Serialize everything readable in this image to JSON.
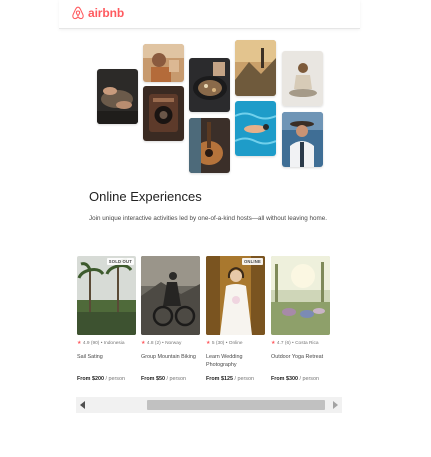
{
  "header": {
    "brand": "airbnb",
    "brand_color": "#ff5a5f",
    "logo_icon": "airbnb-belo-icon"
  },
  "hero": {
    "title": "Online Experiences",
    "description": "Join unique interactive activities led by one-of-a-kind hosts—all without leaving home."
  },
  "cards": [
    {
      "badge": "SOLD OUT",
      "rating": "4.9",
      "reviews": "(90)",
      "location": "Indonesia",
      "title": "Sail Sating",
      "price": "From $200",
      "unit": " / person"
    },
    {
      "badge": "",
      "rating": "4.8",
      "reviews": "(2)",
      "location": "Norway",
      "title": "Group Mountain Biking",
      "price": "From $50",
      "unit": " / person"
    },
    {
      "badge": "ONLINE",
      "rating": "5",
      "reviews": "(30)",
      "location": "Online",
      "title": "Learn Wedding Photography",
      "price": "From $125",
      "unit": " / person"
    },
    {
      "badge": "",
      "rating": "4.7",
      "reviews": "(6)",
      "location": "Costa Rica",
      "title": "Outdoor Yoga Retreat",
      "price": "From $300",
      "unit": " / person"
    }
  ],
  "scrollbar": {
    "left_icon": "scroll-left-arrow-icon",
    "right_icon": "scroll-right-arrow-icon"
  }
}
